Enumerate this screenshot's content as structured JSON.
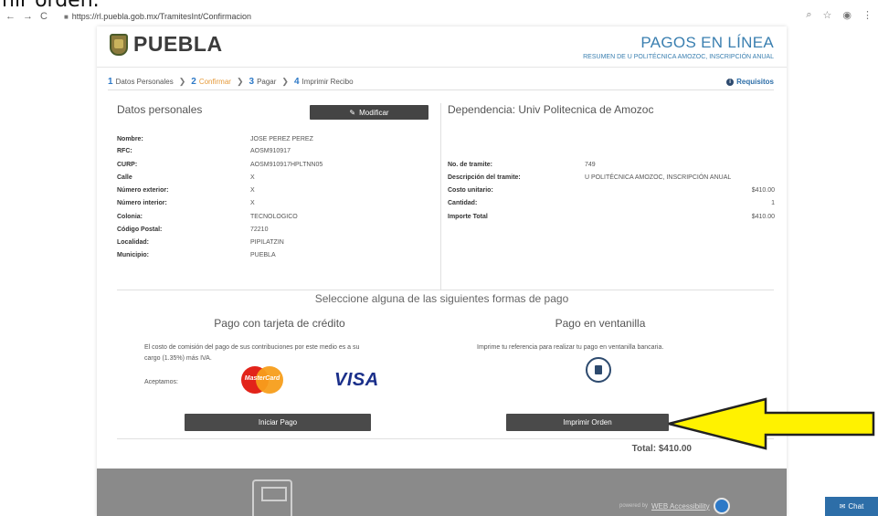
{
  "caption": "nir orden.",
  "browser": {
    "url": "https://rl.puebla.gob.mx/TramitesInt/Confirmacion",
    "back_icon": "←",
    "forward_icon": "→",
    "reload_icon": "C"
  },
  "header": {
    "brand": "PUEBLA",
    "title": "PAGOS EN LÍNEA",
    "subtitle": "RESUMEN DE U POLITÉCNICA AMOZOC, INSCRIPCIÓN ANUAL"
  },
  "steps": [
    {
      "num": "1",
      "label": "Datos Personales"
    },
    {
      "num": "2",
      "label": "Confirmar"
    },
    {
      "num": "3",
      "label": "Pagar"
    },
    {
      "num": "4",
      "label": "Imprimir Recibo"
    }
  ],
  "requisitos": "Requisitos",
  "personal": {
    "title": "Datos personales",
    "modify_label": "Modificar",
    "fields": [
      {
        "k": "Nombre:",
        "v": "JOSE PEREZ PEREZ"
      },
      {
        "k": "RFC:",
        "v": "AOSM910917"
      },
      {
        "k": "CURP:",
        "v": "AOSM910917HPLTNN05"
      },
      {
        "k": "Calle",
        "v": "X"
      },
      {
        "k": "Número exterior:",
        "v": "X"
      },
      {
        "k": "Número interior:",
        "v": "X"
      },
      {
        "k": "Colonia:",
        "v": "TECNOLOGICO"
      },
      {
        "k": "Código Postal:",
        "v": "72210"
      },
      {
        "k": "Localidad:",
        "v": "PIPILATZIN"
      },
      {
        "k": "Municipio:",
        "v": "PUEBLA"
      }
    ]
  },
  "dependencia": {
    "title": "Dependencia: Univ Politecnica de Amozoc",
    "fields": [
      {
        "k": "No. de tramite:",
        "v": "749"
      },
      {
        "k": "Descripción del tramite:",
        "v": "U POLITÉCNICA AMOZOC, INSCRIPCIÓN ANUAL"
      },
      {
        "k": "Costo unitario:",
        "v": "$410.00"
      },
      {
        "k": "Cantidad:",
        "v": "1"
      },
      {
        "k": "Importe Total",
        "v": "$410.00"
      }
    ]
  },
  "payment": {
    "select_title": "Seleccione alguna de las siguientes formas de pago",
    "card": {
      "title": "Pago con tarjeta de crédito",
      "text1": "El costo de comisión del pago de sus contribuciones por este medio es a su",
      "text2": "cargo (1.35%) más IVA.",
      "accept": "Aceptamos:",
      "mastercard": "MasterCard",
      "visa": "VISA",
      "button": "Iniciar Pago"
    },
    "window": {
      "title": "Pago en ventanilla",
      "text": "Imprime tu referencia para realizar tu pago en ventanilla bancaria.",
      "button": "Imprimir Orden"
    },
    "total": "Total: $410.00"
  },
  "footer": {
    "powered": "powered by",
    "accessibility": "WEB Accessibility"
  },
  "chat": "Chat",
  "colors": {
    "accent": "#2d79c7",
    "active_step": "#e59a3a",
    "button": "#4a4a4a",
    "arrow": "#fff200"
  }
}
